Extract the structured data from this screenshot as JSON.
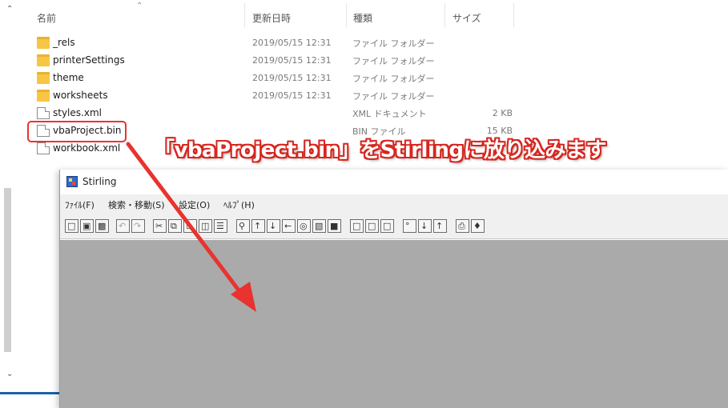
{
  "explorer": {
    "headers": {
      "name": "名前",
      "date": "更新日時",
      "type": "種類",
      "size": "サイズ"
    },
    "files": [
      {
        "name": "_rels",
        "date": "2019/05/15 12:31",
        "type": "ファイル フォルダー",
        "size": "",
        "icon": "folder-icon"
      },
      {
        "name": "printerSettings",
        "date": "2019/05/15 12:31",
        "type": "ファイル フォルダー",
        "size": "",
        "icon": "folder-icon"
      },
      {
        "name": "theme",
        "date": "2019/05/15 12:31",
        "type": "ファイル フォルダー",
        "size": "",
        "icon": "folder-icon"
      },
      {
        "name": "worksheets",
        "date": "2019/05/15 12:31",
        "type": "ファイル フォルダー",
        "size": "",
        "icon": "folder-icon"
      },
      {
        "name": "styles.xml",
        "date": "",
        "type": "XML ドキュメント",
        "size": "2 KB",
        "icon": "file-icon"
      },
      {
        "name": "vbaProject.bin",
        "date": "",
        "type": "BIN ファイル",
        "size": "15 KB",
        "icon": "file-icon"
      },
      {
        "name": "workbook.xml",
        "date": "",
        "type": "",
        "size": "",
        "icon": "file-icon"
      }
    ]
  },
  "stirling": {
    "title": "Stirling",
    "menu": [
      "ﾌｧｲﾙ(F)",
      "検索・移動(S)",
      "設定(O)",
      "ﾍﾙﾌﾟ(H)"
    ],
    "toolbar_icons": [
      "new-file-icon",
      "open-folder-icon",
      "save-icon",
      "undo-icon",
      "redo-icon",
      "cut-icon",
      "copy-icon",
      "paste-icon",
      "paste-special-icon",
      "list-icon",
      "find-icon",
      "find-prev-icon",
      "find-next-icon",
      "find-back-icon",
      "find-all-icon",
      "compare-icon",
      "window-icon",
      "insert-icon",
      "insert-after-icon",
      "insert-end-icon",
      "bit-icon",
      "bit-down-icon",
      "bit-up-icon",
      "print-icon",
      "book-icon"
    ]
  },
  "annotation": {
    "text": "「vbaProject.bin」をStirlingに放り込みます",
    "color": "#d7261f"
  }
}
